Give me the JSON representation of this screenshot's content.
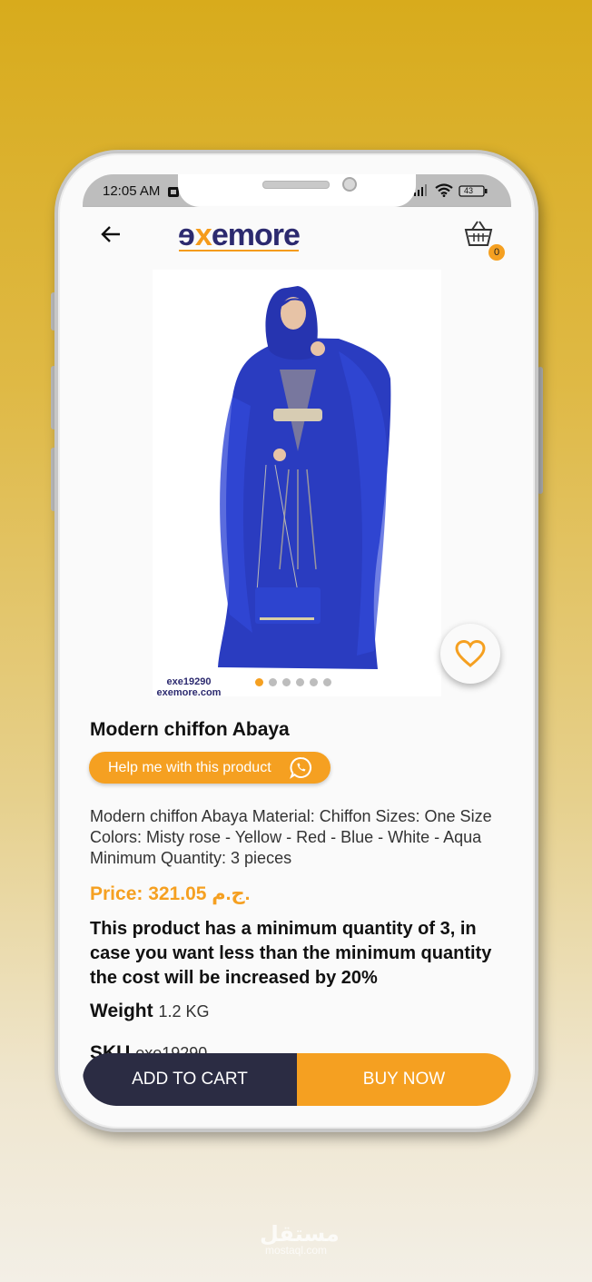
{
  "status_bar": {
    "time": "12:05 AM",
    "battery": "43"
  },
  "header": {
    "logo_text_a": "e",
    "logo_text_x": "x",
    "logo_text_b": "emore",
    "cart_count": "0"
  },
  "product": {
    "image_caption_code": "exe19290",
    "image_caption_site": "exemore.com",
    "carousel_total": 6,
    "carousel_active": 1,
    "title": "Modern chiffon Abaya",
    "help_button": "Help me with this product",
    "description": "Modern chiffon Abaya Material: Chiffon Sizes: One Size Colors: Misty rose - Yellow - Red - Blue - White - Aqua Minimum Quantity: 3 pieces",
    "price_label": "Price: 321.05",
    "currency": "ج.م.",
    "min_qty_notice": "This product has a minimum quantity of 3, in case you want less than the minimum quantity the cost will be increased by 20%",
    "weight_label": "Weight",
    "weight_value": "1.2 KG",
    "sku_label": "SKU",
    "sku_value": "exe19290"
  },
  "actions": {
    "add_to_cart": "ADD TO CART",
    "buy_now": "BUY NOW"
  },
  "watermark": {
    "arabic": "مستقل",
    "latin": "mostaql.com"
  },
  "colors": {
    "accent": "#f5a021",
    "brand": "#2c2a6f",
    "dark_button": "#2b2c43",
    "dress_blue": "#2a3cc0"
  }
}
